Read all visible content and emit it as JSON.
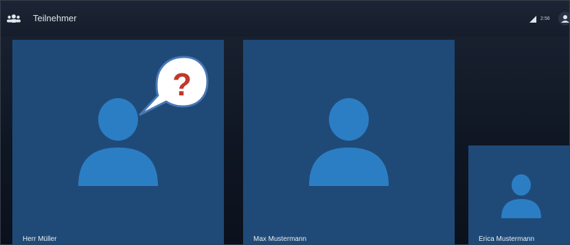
{
  "header": {
    "title": "Teilnehmer",
    "time": "2:56",
    "icons": [
      "people-icon",
      "signal-icon",
      "account-icon"
    ]
  },
  "participants": [
    {
      "name": "Herr Müller"
    },
    {
      "name": "Max Mustermann"
    },
    {
      "name": "Erica Mustermann"
    }
  ],
  "annotation": {
    "symbol": "?",
    "icon": "question-speech-bubble"
  },
  "colors": {
    "background": "#0f1623",
    "tile": "#1f4a78",
    "avatar": "#2c7ec4",
    "bubble_fill": "#ffffff",
    "bubble_border": "#4a78b5",
    "question_mark": "#c0392b"
  }
}
